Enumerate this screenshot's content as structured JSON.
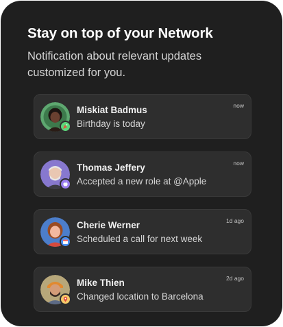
{
  "header": {
    "title": "Stay on top of your Network",
    "subtitle": "Notification about relevant updates customized for you."
  },
  "colors": {
    "card_background": "#1f1f1f",
    "item_background": "#2e2e2e",
    "badge_green": "#5cd67a",
    "badge_purple": "#9b7ff0",
    "badge_blue": "#4a8ff0",
    "badge_yellow": "#f6c96a"
  },
  "notifications": [
    {
      "name": "Miskiat Badmus",
      "message": "Birthday is today",
      "time": "now",
      "avatar": "person-avatar",
      "badge_icon": "party-icon",
      "badge_color": "#5cd67a"
    },
    {
      "name": "Thomas Jeffery",
      "message": "Accepted a new role at @Apple",
      "time": "now",
      "avatar": "person-avatar",
      "badge_icon": "apple-icon",
      "badge_color": "#9b7ff0"
    },
    {
      "name": "Cherie Werner",
      "message": "Scheduled a call for next week",
      "time": "1d ago",
      "avatar": "person-avatar",
      "badge_icon": "calendar-icon",
      "badge_color": "#4a8ff0"
    },
    {
      "name": "Mike Thien",
      "message": "Changed location to Barcelona",
      "time": "2d ago",
      "avatar": "person-avatar",
      "badge_icon": "location-pin-icon",
      "badge_color": "#f6c96a"
    }
  ]
}
